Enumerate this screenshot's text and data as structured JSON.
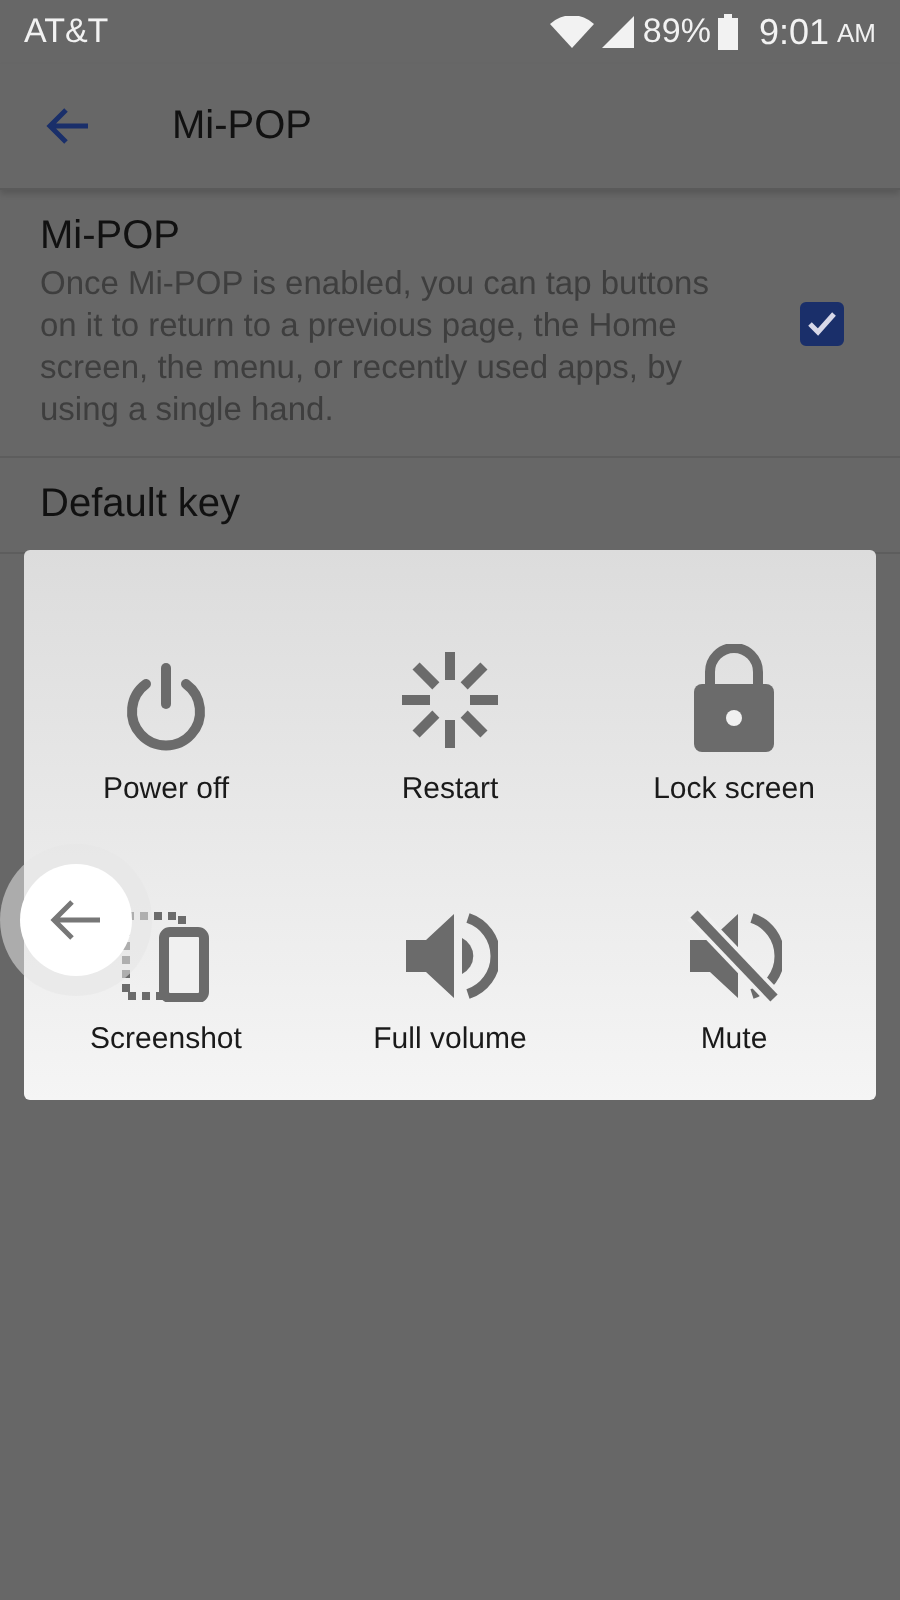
{
  "status_bar": {
    "carrier": "AT&T",
    "battery": "89%",
    "time": "9:01",
    "ampm": "AM"
  },
  "toolbar": {
    "title": "Mi-POP"
  },
  "settings": [
    {
      "kind": "toggle",
      "title": "Mi-POP",
      "description": "Once Mi-POP is enabled, you can tap buttons on it to return to a previous page, the Home screen, the menu, or recently used apps, by using a single hand.",
      "checked": true
    },
    {
      "kind": "header",
      "title": "Default key"
    }
  ],
  "dialog": {
    "actions": [
      {
        "kind": "power",
        "label": "Power off"
      },
      {
        "kind": "restart",
        "label": "Restart"
      },
      {
        "kind": "lock",
        "label": "Lock screen"
      },
      {
        "kind": "screenshot",
        "label": "Screenshot"
      },
      {
        "kind": "volume",
        "label": "Full volume"
      },
      {
        "kind": "mute",
        "label": "Mute"
      }
    ]
  }
}
